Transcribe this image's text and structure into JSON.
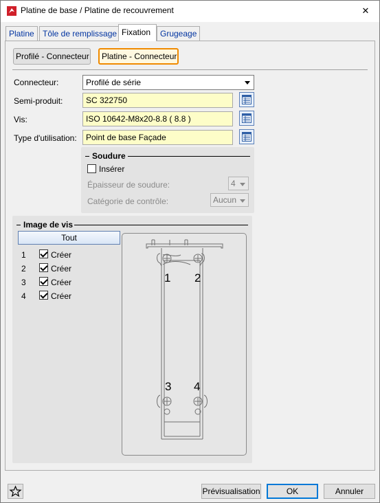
{
  "window": {
    "title": "Platine de base / Platine de recouvrement",
    "close_glyph": "✕"
  },
  "tabs": [
    {
      "label": "Platine"
    },
    {
      "label": "Tôle de remplissage"
    },
    {
      "label": "Fixation",
      "active": true
    },
    {
      "label": "Grugeage"
    }
  ],
  "subtabs": [
    {
      "label": "Profilé - Connecteur"
    },
    {
      "label": "Platine - Connecteur",
      "active": true
    }
  ],
  "form": {
    "connecteur": {
      "label": "Connecteur:",
      "value": "Profilé de série"
    },
    "semi_produit": {
      "label": "Semi-produit:",
      "value": "SC  322750"
    },
    "vis": {
      "label": "Vis:",
      "value": "ISO 10642-M8x20-8.8  ( 8.8 )"
    },
    "type_utilisation": {
      "label": "Type d'utilisation:",
      "value": "Point de base Façade"
    }
  },
  "soudure": {
    "title": "Soudure",
    "inserer_label": "Insérer",
    "inserer_checked": false,
    "epaisseur_label": "Épaisseur de soudure:",
    "epaisseur_value": "4",
    "categorie_label": "Catégorie de contrôle:",
    "categorie_value": "Aucun"
  },
  "image_de_vis": {
    "title": "Image de vis",
    "all_button": "Tout",
    "rows": [
      {
        "num": "1",
        "label": "Créer",
        "checked": true
      },
      {
        "num": "2",
        "label": "Créer",
        "checked": true
      },
      {
        "num": "3",
        "label": "Créer",
        "checked": true
      },
      {
        "num": "4",
        "label": "Créer",
        "checked": true
      }
    ],
    "preview_labels": [
      "1",
      "2",
      "3",
      "4"
    ]
  },
  "footer": {
    "favorite_icon": "star-icon",
    "preview_button": "Prévisualisation",
    "ok_button": "OK",
    "cancel_button": "Annuler"
  },
  "colors": {
    "field_bg": "#fdfdc8",
    "active_subtab_border": "#f08a00",
    "default_button_border": "#0078d7"
  }
}
